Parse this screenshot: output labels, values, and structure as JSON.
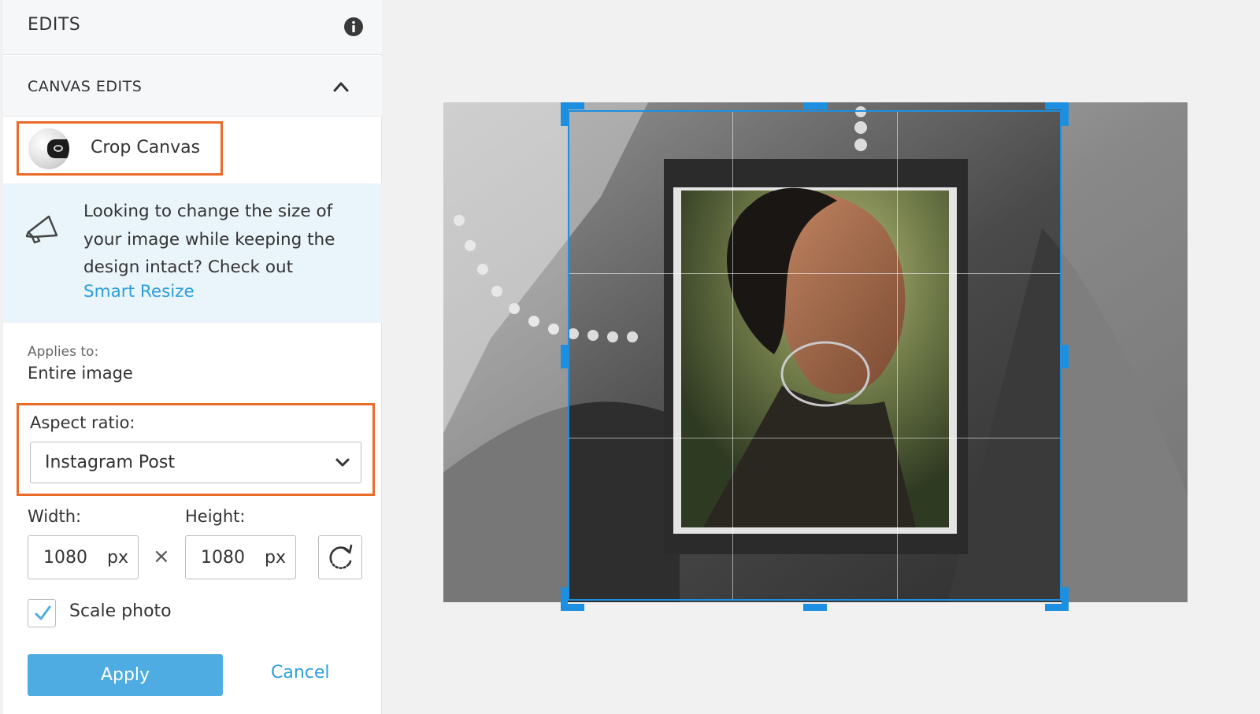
{
  "panel": {
    "title": "EDITS",
    "section_title": "CANVAS EDITS",
    "tool_label": "Crop Canvas",
    "promo": {
      "text": "Looking to change the size of your image while keeping the design intact? Check out",
      "link": "Smart Resize"
    },
    "applies": {
      "label": "Applies to:",
      "value": "Entire image"
    },
    "aspect": {
      "label": "Aspect ratio:",
      "value": "Instagram Post"
    },
    "width": {
      "label": "Width:",
      "value": "1080",
      "unit": "px"
    },
    "height": {
      "label": "Height:",
      "value": "1080",
      "unit": "px"
    },
    "times": "×",
    "scale": {
      "label": "Scale photo",
      "checked": true
    },
    "apply_label": "Apply",
    "cancel_label": "Cancel"
  },
  "icons": {
    "info": "info-icon",
    "collapse": "chevron-up-icon",
    "promo": "megaphone-icon",
    "dropdown": "chevron-down-icon",
    "swap": "rotate-icon",
    "check": "checkmark-icon"
  },
  "colors": {
    "accent_orange": "#ea6a27",
    "link_blue": "#2e9fdc",
    "apply_blue": "#4eace3",
    "crop_blue": "#1d8fe0",
    "promo_bg": "#eaf4fb"
  }
}
